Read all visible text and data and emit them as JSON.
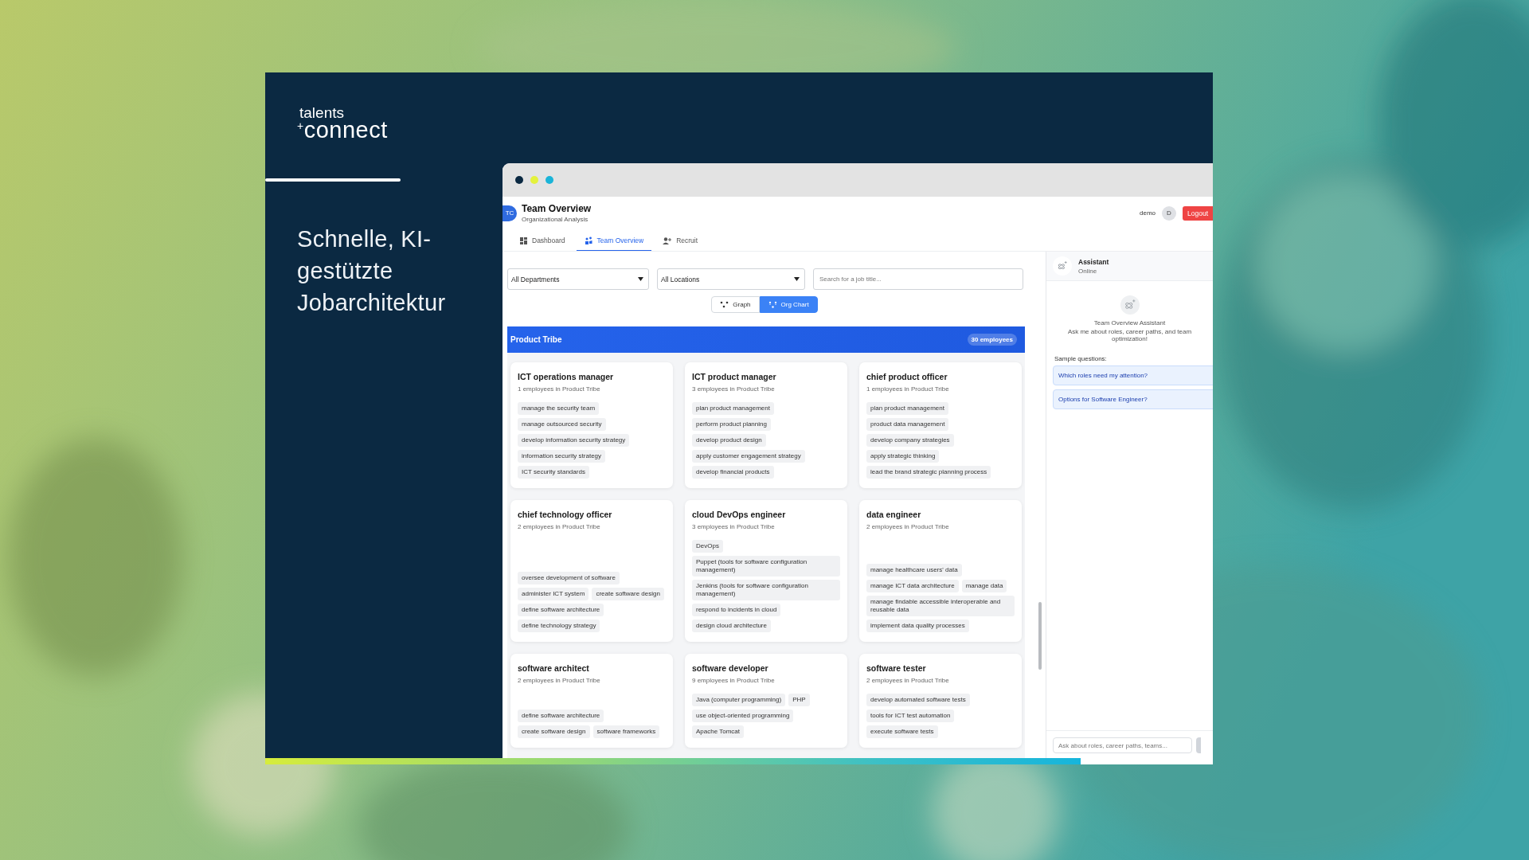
{
  "slide": {
    "logo": [
      "talents",
      "$^{+}$connect"
    ],
    "headline": "Schnelle, KI-gestützte Jobarchitektur"
  },
  "app": {
    "window_dots": [
      {
        "color": "#0b2942"
      },
      {
        "color": "#e4f23c"
      },
      {
        "color": "#1ab4d8"
      }
    ],
    "header": {
      "logo": "TC",
      "title": "Team Overview",
      "subtitle": "Organizational Analysis",
      "user": "demo",
      "avatar": "D",
      "logout": "Logout"
    },
    "tabs": [
      {
        "label": "Dashboard",
        "kind": "dashboard",
        "selected": false
      },
      {
        "label": "Team Overview",
        "kind": "team",
        "selected": true
      },
      {
        "label": "Recruit",
        "kind": "recruit",
        "selected": false
      }
    ],
    "filters": {
      "department": "All Departments",
      "location": "All Locations",
      "search": {
        "placeholder": "Search for a job title..."
      }
    },
    "view_toggle": [
      {
        "label": "Graph",
        "kind": "graph",
        "selected": false
      },
      {
        "label": "Org Chart",
        "kind": "org",
        "selected": true
      }
    ],
    "group": {
      "name": "Product Tribe",
      "count": "30 employees"
    },
    "cards": [
      {
        "title": "ICT operations manager",
        "subtitle": "1 employees in Product Tribe",
        "skills": [
          "manage the security team",
          "manage outsourced security",
          "develop information security strategy",
          "information security strategy",
          "ICT security standards"
        ]
      },
      {
        "title": "ICT product manager",
        "subtitle": "3 employees in Product Tribe",
        "skills": [
          "plan product management",
          "perform product planning",
          "develop product design",
          "apply customer engagement strategy",
          "develop financial products"
        ]
      },
      {
        "title": "chief product officer",
        "subtitle": "1 employees in Product Tribe",
        "skills": [
          "plan product management",
          "product data management",
          "develop company strategies",
          "apply strategic thinking",
          "lead the brand strategic planning process"
        ]
      },
      {
        "title": "chief technology officer",
        "subtitle": "2 employees in Product Tribe",
        "skills": [
          "oversee development of software",
          "administer ICT system",
          "create software design",
          "define software architecture",
          "define technology strategy"
        ]
      },
      {
        "title": "cloud DevOps engineer",
        "subtitle": "3 employees in Product Tribe",
        "skills": [
          "DevOps",
          "Puppet (tools for software configuration management)",
          "Jenkins (tools for software configuration management)",
          "respond to incidents in cloud",
          "design cloud architecture"
        ]
      },
      {
        "title": "data engineer",
        "subtitle": "2 employees in Product Tribe",
        "skills": [
          "manage healthcare users' data",
          "manage ICT data architecture",
          "manage data",
          "manage findable accessible interoperable and reusable data",
          "implement data quality processes"
        ]
      },
      {
        "title": "software architect",
        "subtitle": "2 employees in Product Tribe",
        "skills": [
          "define software architecture",
          "create software design",
          "software frameworks"
        ]
      },
      {
        "title": "software developer",
        "subtitle": "9 employees in Product Tribe",
        "skills": [
          "Java (computer programming)",
          "PHP",
          "use object-oriented programming",
          "Apache Tomcat"
        ]
      },
      {
        "title": "software tester",
        "subtitle": "2 employees in Product Tribe",
        "skills": [
          "develop automated software tests",
          "tools for ICT test automation",
          "execute software tests"
        ]
      }
    ],
    "assistant": {
      "title": "Assistant",
      "status": "Online",
      "welcome_title": "Team Overview Assistant",
      "welcome_text": "Ask me about roles, career paths, and team optimization!",
      "sample_label": "Sample questions:",
      "questions": [
        "Which roles need my attention?",
        "Options for Software Engineer?"
      ],
      "input": {
        "placeholder": "Ask about roles, career paths, teams..."
      }
    }
  }
}
